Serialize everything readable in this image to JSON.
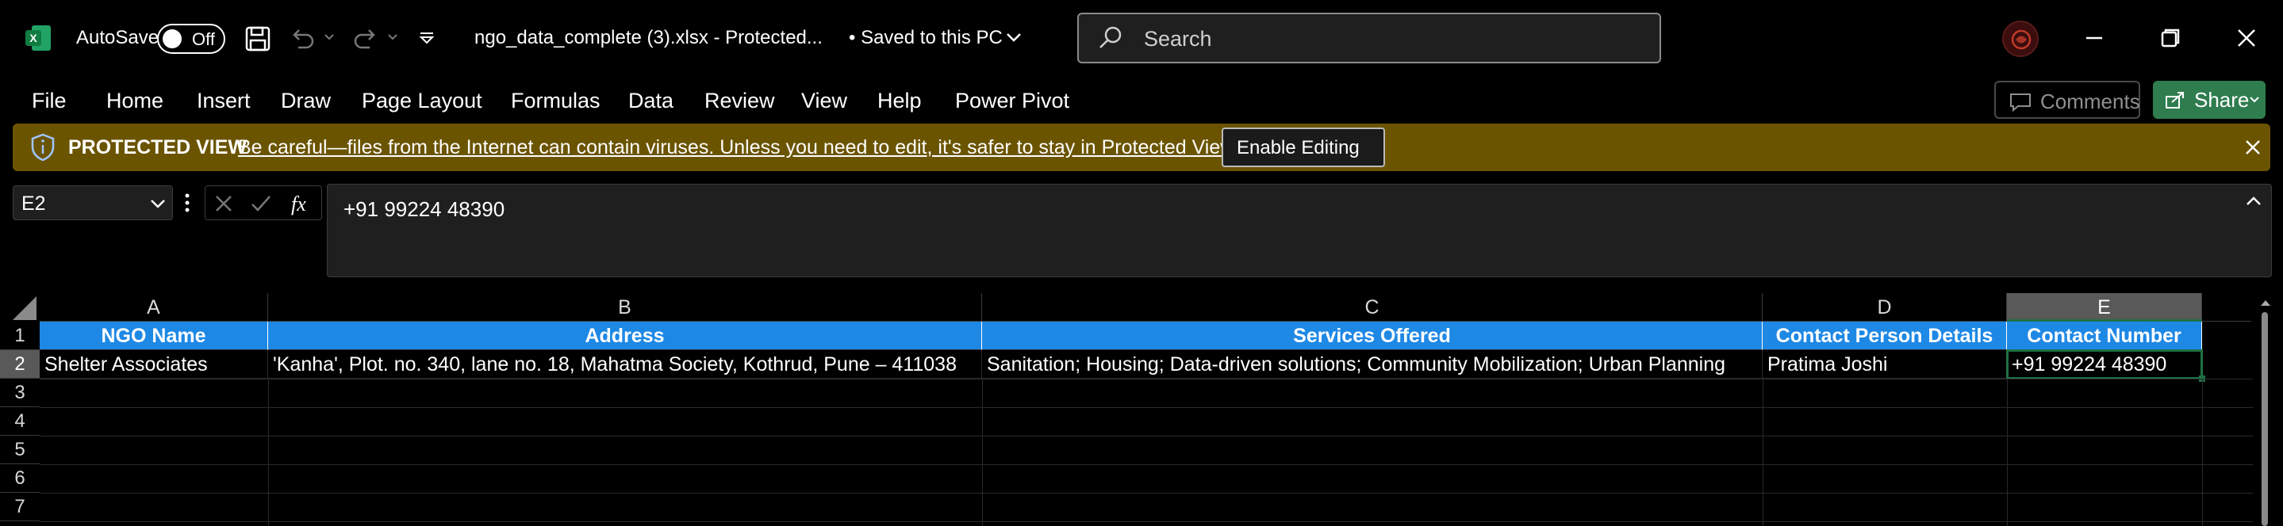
{
  "titlebar": {
    "autosave_label": "AutoSave",
    "autosave_state": "Off",
    "filename": "ngo_data_complete (3).xlsx  -  Protected...",
    "save_status": "•  Saved to this PC",
    "search_placeholder": "Search"
  },
  "ribbon": {
    "tabs": [
      "File",
      "Home",
      "Insert",
      "Draw",
      "Page Layout",
      "Formulas",
      "Data",
      "Review",
      "View",
      "Help",
      "Power Pivot"
    ],
    "comments_label": "Comments",
    "share_label": "Share"
  },
  "protected_view": {
    "title": "PROTECTED VIEW",
    "message": "Be careful—files from the Internet can contain viruses. Unless you need to edit, it's safer to stay in Protected View.",
    "enable_label": "Enable Editing"
  },
  "formula_bar": {
    "name_box": "E2",
    "formula": "+91 99224 48390"
  },
  "grid": {
    "columns": [
      "A",
      "B",
      "C",
      "D",
      "E"
    ],
    "rows": [
      "1",
      "2",
      "3",
      "4",
      "5",
      "6",
      "7"
    ],
    "header_row": [
      "NGO Name",
      "Address",
      "Services Offered",
      "Contact Person Details",
      "Contact Number"
    ],
    "data_row": [
      "Shelter Associates",
      "'Kanha', Plot. no. 340, lane no. 18, Mahatma Society, Kothrud, Pune – 411038",
      "Sanitation; Housing; Data-driven solutions; Community Mobilization; Urban Planning",
      "Pratima Joshi",
      "+91 99224 48390"
    ],
    "active_cell": "E2"
  },
  "colors": {
    "header_fill": "#1e88e5",
    "protected_bar": "#6b5400",
    "selection": "#1e7145",
    "share_button": "#2f7d4f"
  }
}
